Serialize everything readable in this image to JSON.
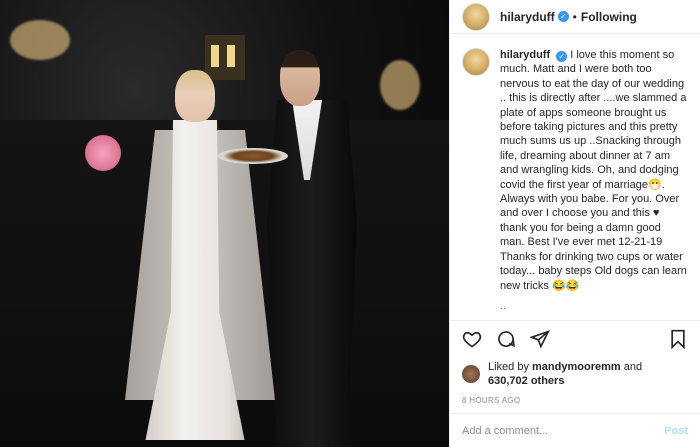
{
  "header": {
    "username": "hilaryduff",
    "following": "Following",
    "verified_icon": "check-icon"
  },
  "caption": {
    "username": "hilaryduff",
    "text": "I love this moment so much. Matt and I were both too nervous to eat the day of our wedding .. this is directly after ....we slammed a plate of apps someone brought us before taking pictures and this pretty much sums us up ..Snacking through life, dreaming about dinner at 7 am and wrangling kids. Oh, and dodging covid the first year of marriage😷. Always with you babe. For you. Over and over I choose you and this ♥ thank you for being a damn good man. Best I've ever met 12-21-19",
    "text2": "Thanks for drinking two cups or water today... baby steps Old dogs can learn new tricks 😂😂"
  },
  "actions": {
    "like_icon": "heart-icon",
    "comment_icon": "comment-icon",
    "share_icon": "share-icon",
    "save_icon": "bookmark-icon"
  },
  "likes": {
    "prefix": "Liked by ",
    "user": "mandymooremm",
    "conj": " and",
    "count": "630,702 others"
  },
  "timestamp": "8 HOURS AGO",
  "comment_input": {
    "placeholder": "Add a comment...",
    "post_label": "Post"
  },
  "colors": {
    "accent": "#3897f0",
    "post_disabled": "#b2dffc"
  }
}
